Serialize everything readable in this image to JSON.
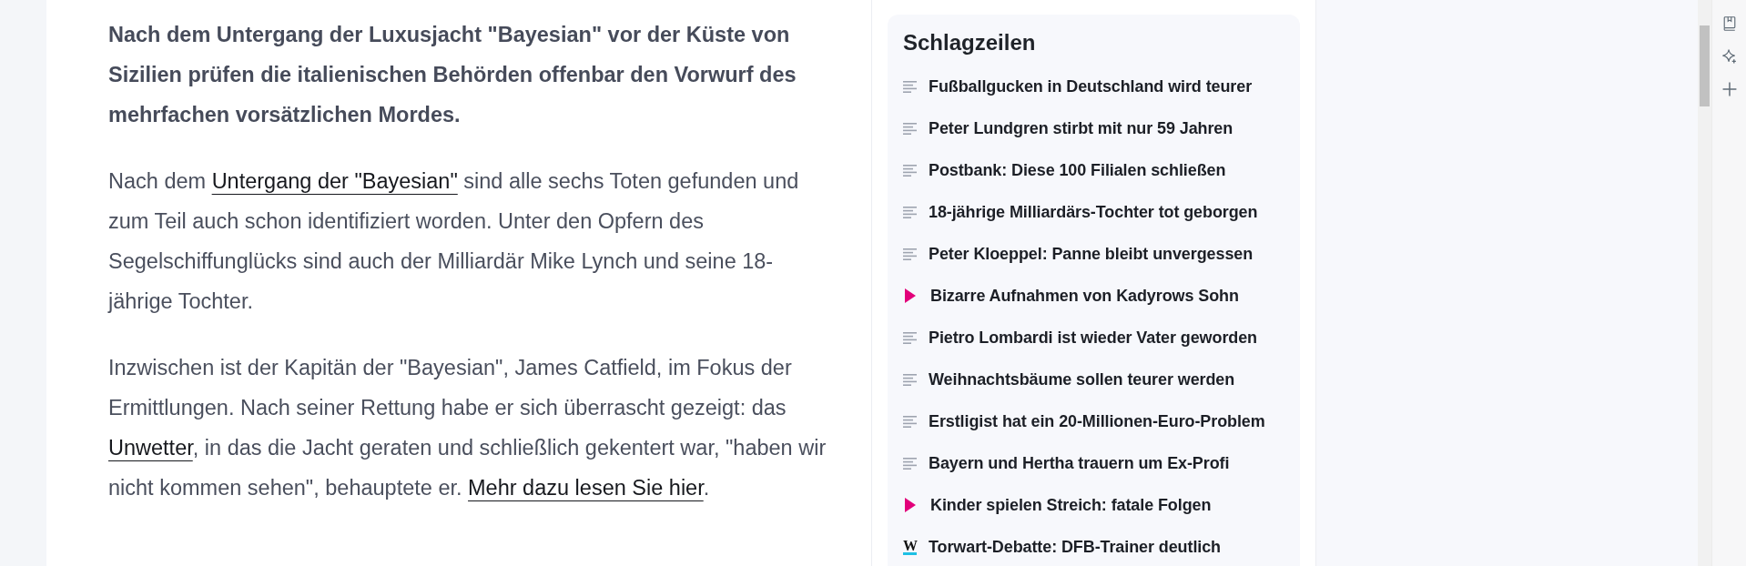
{
  "article": {
    "lead": "Nach dem Untergang der Luxusjacht \"Bayesian\" vor der Küste von Sizilien prüfen die italienischen Behörden offenbar den Vorwurf des mehrfachen vorsätzlichen Mordes.",
    "paragraphs": [
      {
        "segments": [
          {
            "kind": "text",
            "text": "Nach dem "
          },
          {
            "kind": "link",
            "text": "Untergang der \"Bayesian\""
          },
          {
            "kind": "text",
            "text": " sind alle sechs Toten gefunden und zum Teil auch schon identifiziert worden. Unter den Opfern des Segelschiffunglücks sind auch der Milliardär Mike Lynch und seine 18-jährige Tochter."
          }
        ]
      },
      {
        "segments": [
          {
            "kind": "text",
            "text": "Inzwischen ist der Kapitän der \"Bayesian\", James Catfield, im Fokus der Ermittlungen. Nach seiner Rettung habe er sich überrascht gezeigt: das "
          },
          {
            "kind": "link",
            "text": "Unwetter"
          },
          {
            "kind": "text",
            "text": ", in das die Jacht geraten und schließlich gekentert war, \"haben wir nicht kommen sehen\", behauptete er. "
          },
          {
            "kind": "link",
            "text": "Mehr dazu lesen Sie hier"
          },
          {
            "kind": "text",
            "text": "."
          }
        ]
      }
    ]
  },
  "headlines": {
    "title": "Schlagzeilen",
    "items": [
      {
        "kind": "article",
        "title": "Fußballgucken in Deutschland wird teurer"
      },
      {
        "kind": "article",
        "title": "Peter Lundgren stirbt mit nur 59 Jahren"
      },
      {
        "kind": "article",
        "title": "Postbank: Diese 100 Filialen schließen"
      },
      {
        "kind": "article",
        "title": "18-jährige Milliardärs-Tochter tot geborgen"
      },
      {
        "kind": "article",
        "title": "Peter Kloeppel: Panne bleibt unvergessen"
      },
      {
        "kind": "video",
        "title": "Bizarre Aufnahmen von Kadyrows Sohn"
      },
      {
        "kind": "article",
        "title": "Pietro Lombardi ist wieder Vater geworden"
      },
      {
        "kind": "article",
        "title": "Weihnachtsbäume sollen teurer werden"
      },
      {
        "kind": "article",
        "title": "Erstligist hat ein 20-Millionen-Euro-Problem"
      },
      {
        "kind": "article",
        "title": "Bayern und Hertha trauern um Ex-Profi"
      },
      {
        "kind": "video",
        "title": "Kinder spielen Streich: fatale Folgen"
      },
      {
        "kind": "partner",
        "logo": "W",
        "title": "Torwart-Debatte: DFB-Trainer deutlich"
      }
    ]
  }
}
